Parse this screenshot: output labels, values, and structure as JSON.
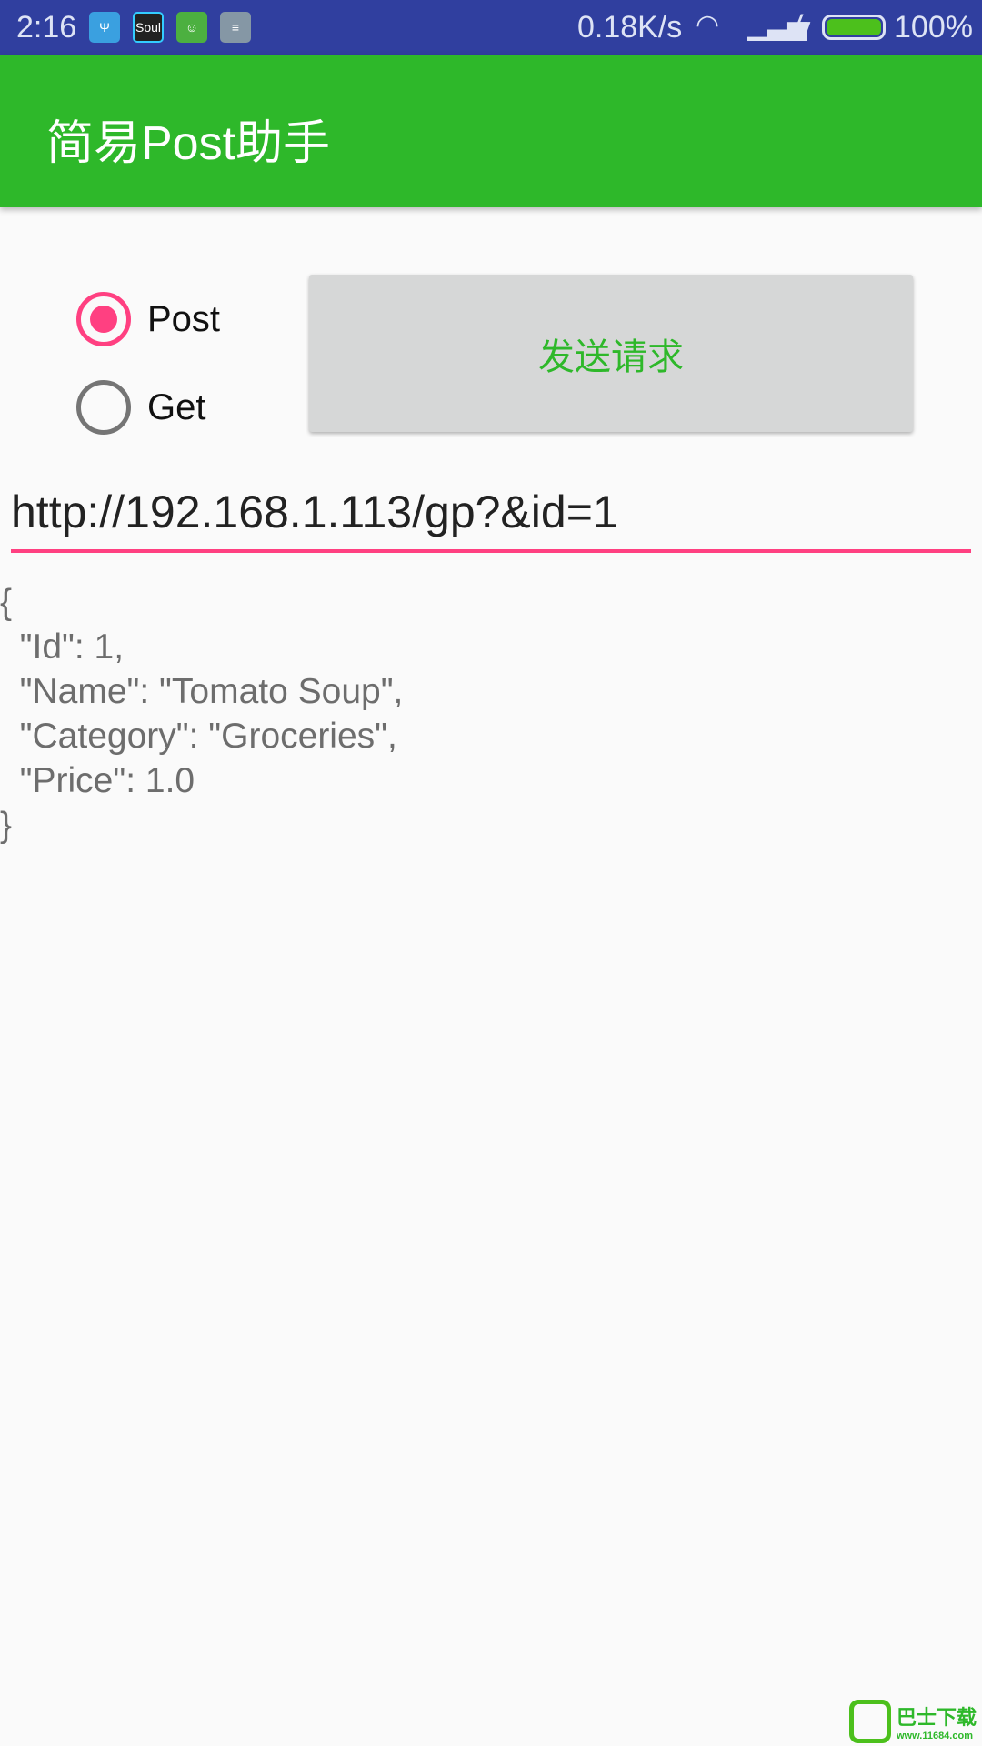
{
  "status_bar": {
    "time": "2:16",
    "notification_icons": [
      "usb-icon",
      "soul-app-icon",
      "android-icon",
      "storage-icon"
    ],
    "soul_label": "Soul",
    "net_speed": "0.18K/s",
    "battery_percent": "100%",
    "battery_level": 100,
    "colors": {
      "bg": "#303f9f",
      "battery": "#4cc01c"
    }
  },
  "app_bar": {
    "title": "简易Post助手",
    "color": "#2eb82a"
  },
  "method": {
    "options": [
      {
        "label": "Post",
        "selected": true
      },
      {
        "label": "Get",
        "selected": false
      }
    ],
    "accent": "#ff4081"
  },
  "send_button": {
    "label": "发送请求"
  },
  "url_field": {
    "value": "http://192.168.1.113/gp?&id=1"
  },
  "response": {
    "text": "{\n  \"Id\": 1,\n  \"Name\": \"Tomato Soup\",\n  \"Category\": \"Groceries\",\n  \"Price\": 1.0\n}"
  },
  "watermark": {
    "title": "巴士下载",
    "url": "www.11684.com"
  }
}
